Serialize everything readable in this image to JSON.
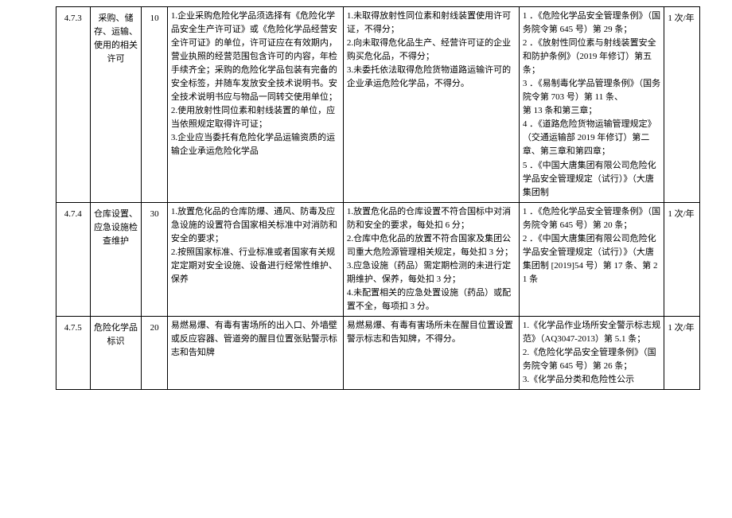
{
  "rows": [
    {
      "id": "4.7.3",
      "item": "采购、储存、运输、使用的相关许可",
      "score": "10",
      "standard": "1.企业采购危险化学品须选择有《危险化学品安全生产许可证》或《危险化学品经营安全许可证》的单位，许可证应在有效期内，营业执照的经营范围包含许可的内容，年检手续齐全；采购的危险化学品包装有完备的安全标签，并随车发放安全技术说明书。安全技术说明书应与物品一同转交使用单位；2.使用放射性同位素和射线装置的单位，应当依照规定取得许可证；\n3.企业应当委托有危险化学品运输资质的运输企业承运危险化学品",
      "method": "1.未取得放射性同位素和射线装置使用许可证，不得分；\n2.向未取得危化品生产、经营许可证的企业购买危化品，不得分；\n3.未委托依法取得危险货物道路运输许可的企业承运危险化学品，不得分。",
      "basis": "1 ．《危险化学品安全管理条例》（国务院令第 645 号）第 29 条；\n2 ．《放射性同位素与射线装置安全和防护条例》（2019 年修订）第五条；\n3 ．《易制毒化学品管理条例》（国务院令第 703 号）第 11 条、\n第 13 条和第三章；\n4 ．《道路危险货物运输管理规定》（交通运输部 2019 年修订）第二章、第三章和第四章；\n5 ．《中国大唐集团有限公司危险化学品安全管理规定（试行）》（大唐集团制",
      "freq": "1 次/年"
    },
    {
      "id": "4.7.4",
      "item": "仓库设置、应急设施检查维护",
      "score": "30",
      "standard": "1.放置危化品的仓库防爆、通风、防毒及应急设施的设置符合国家相关标准中对消防和安全的要求；\n2.按照国家标准、行业标准或者国家有关规定定期对安全设施、设备进行经常性维护、保养",
      "method": "1.放置危化品的仓库设置不符合国标中对消防和安全的要求，每处扣 6 分；\n2.仓库中危化品的放置不符合国家及集团公司重大危险源管理相关规定，每处扣 3 分；\n3.应急设施（药品）需定期检测的未进行定期维护、保养，每处扣 3 分；\n4.未配置相关的应急处置设施（药品）或配置不全，每项扣 3 分。",
      "basis": "1 ．《危险化学品安全管理条例》（国务院令第 645 号）第 20 条；\n2 ．《中国大唐集团有限公司危险化学品安全管理规定（试行）》（大唐集团制 [2019]54 号）第 17 条、第 21 条",
      "freq": "1 次/年"
    },
    {
      "id": "4.7.5",
      "item": "危险化学品标识",
      "score": "20",
      "standard": "易燃易爆、有毒有害场所的出入口、外墙壁或反应容器、管道旁的醒目位置张贴警示标志和告知牌",
      "method": "易燃易爆、有毒有害场所未在醒目位置设置警示标志和告知牌，不得分。",
      "basis": "1.《化学品作业场所安全警示标志规范》（AQ3047-2013）第 5.1 条；\n2.《危险化学品安全管理条例》（国务院令第 645 号）第 26 条；\n3.《化学品分类和危险性公示",
      "freq": "1 次/年"
    }
  ]
}
